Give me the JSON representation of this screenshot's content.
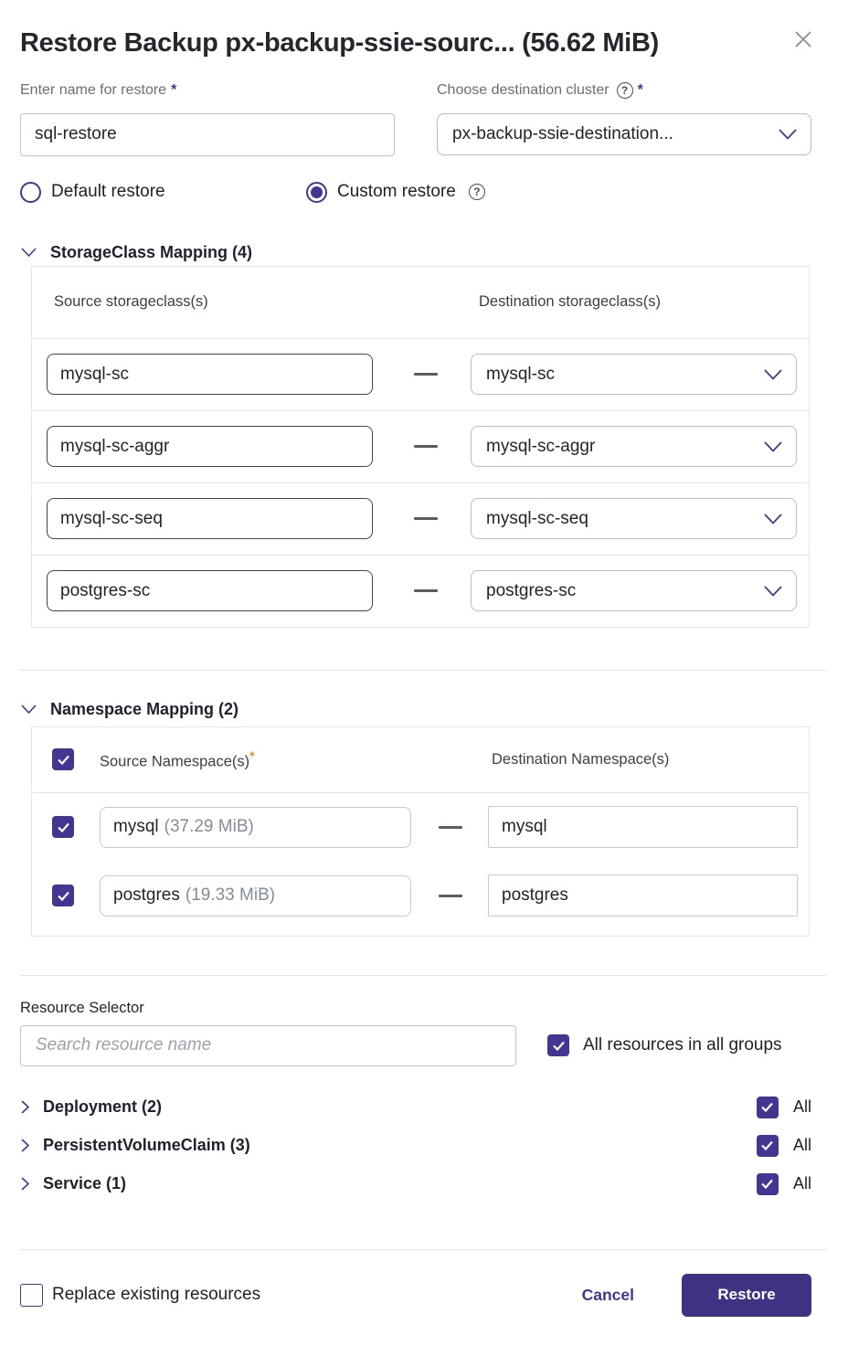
{
  "colors": {
    "accent": "#453593",
    "button": "#3e3282",
    "required_orange": "#ed8936"
  },
  "header": {
    "title": "Restore Backup px-backup-ssie-sourc...  (56.62 MiB)"
  },
  "icons": {
    "help": "?"
  },
  "form": {
    "name_label": "Enter name for restore",
    "name_required": "*",
    "name_value": "sql-restore",
    "cluster_label": "Choose destination cluster",
    "cluster_required": "*",
    "cluster_value": "px-backup-ssie-destination...",
    "radio_default_label": "Default restore",
    "radio_custom_label": "Custom restore",
    "selected_radio": "Custom restore"
  },
  "storageclass_mapping": {
    "title": "StorageClass Mapping (4)",
    "source_header": "Source storageclass(s)",
    "destination_header": "Destination storageclass(s)",
    "rows": [
      {
        "source": "mysql-sc",
        "destination": "mysql-sc"
      },
      {
        "source": "mysql-sc-aggr",
        "destination": "mysql-sc-aggr"
      },
      {
        "source": "mysql-sc-seq",
        "destination": "mysql-sc-seq"
      },
      {
        "source": "postgres-sc",
        "destination": "postgres-sc"
      }
    ]
  },
  "namespace_mapping": {
    "title": "Namespace Mapping (2)",
    "source_header": "Source Namespace(s)",
    "source_required": "*",
    "destination_header": "Destination Namespace(s)",
    "rows": [
      {
        "source": "mysql",
        "size": "(37.29 MiB)",
        "destination": "mysql",
        "checked": true
      },
      {
        "source": "postgres",
        "size": "(19.33 MiB)",
        "destination": "postgres",
        "checked": true
      }
    ]
  },
  "resource_selector": {
    "label": "Resource Selector",
    "search_placeholder": "Search resource name",
    "all_groups_label": "All resources in all groups",
    "all_groups_checked": true,
    "groups": [
      {
        "label": "Deployment (2)",
        "all_label": "All",
        "checked": true
      },
      {
        "label": "PersistentVolumeClaim (3)",
        "all_label": "All",
        "checked": true
      },
      {
        "label": "Service (1)",
        "all_label": "All",
        "checked": true
      }
    ]
  },
  "footer": {
    "replace_label": "Replace existing resources",
    "replace_checked": false,
    "cancel_label": "Cancel",
    "restore_label": "Restore"
  }
}
